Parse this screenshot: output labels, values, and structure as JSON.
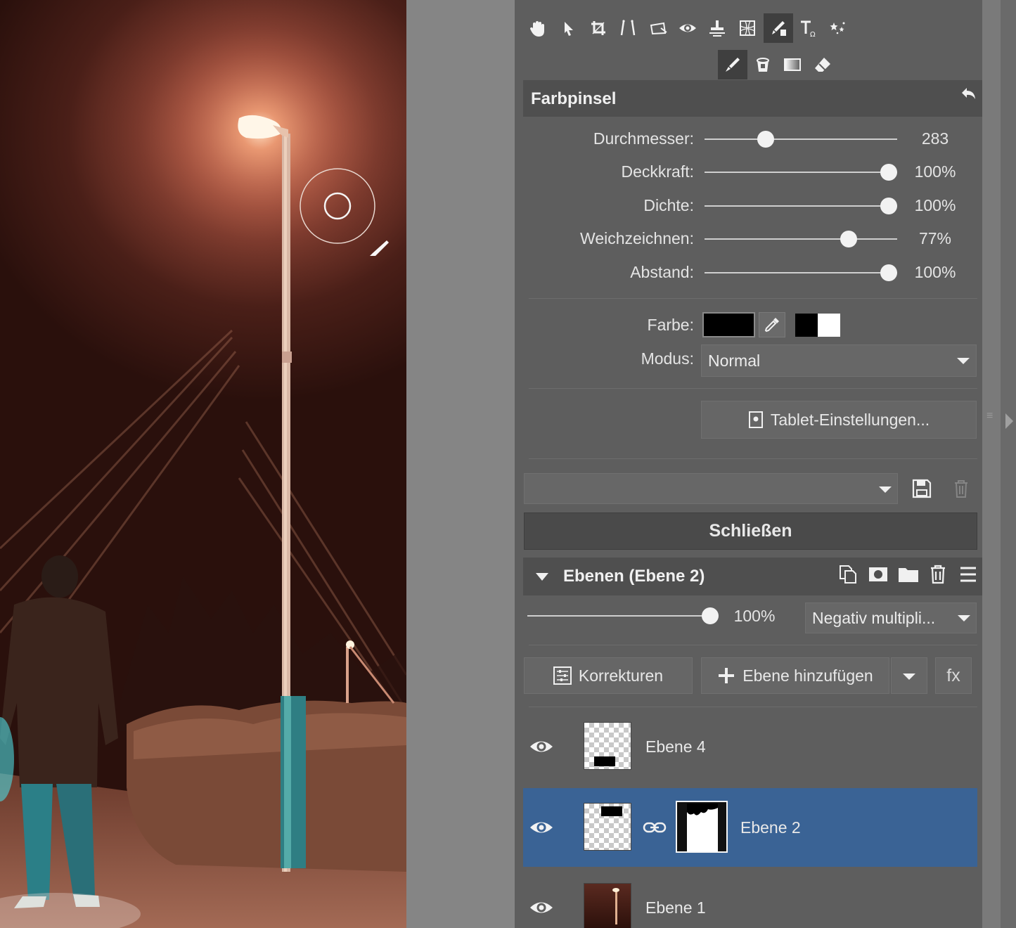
{
  "toolbar": {
    "tools": [
      "hand-icon",
      "pointer-icon",
      "crop-icon",
      "straighten-icon",
      "perspective-icon",
      "redeye-icon",
      "clone-stamp-icon",
      "warp-icon",
      "color-brush-icon",
      "text-icon",
      "effects-icon"
    ],
    "subtools": [
      "brush-icon",
      "bucket-icon",
      "gradient-icon",
      "eraser-icon"
    ]
  },
  "brush_panel": {
    "title": "Farbpinsel",
    "sliders": [
      {
        "label": "Durchmesser:",
        "value": "283",
        "position": 0.3
      },
      {
        "label": "Deckkraft:",
        "value": "100%",
        "position": 1.0
      },
      {
        "label": "Dichte:",
        "value": "100%",
        "position": 1.0
      },
      {
        "label": "Weichzeichnen:",
        "value": "77%",
        "position": 0.77
      },
      {
        "label": "Abstand:",
        "value": "100%",
        "position": 1.0
      }
    ],
    "color_label": "Farbe:",
    "color_value": "#000000",
    "mode_label": "Modus:",
    "mode_value": "Normal",
    "tablet_button": "Tablet-Einstellungen...",
    "preset_value": "",
    "close_button": "Schließen"
  },
  "layers_panel": {
    "title": "Ebenen (Ebene 2)",
    "opacity": "100%",
    "opacity_position": 1.0,
    "blend_mode": "Negativ multipli...",
    "corrections_button": "Korrekturen",
    "add_layer_button": "Ebene hinzufügen",
    "fx_button": "fx",
    "layers": [
      {
        "name": "Ebene 4",
        "selected": false
      },
      {
        "name": "Ebene 2",
        "selected": true
      },
      {
        "name": "Ebene 1",
        "selected": false
      }
    ]
  },
  "colors": {
    "accent_selected": "#3a6395",
    "panel_bg": "#5e5e5e"
  }
}
